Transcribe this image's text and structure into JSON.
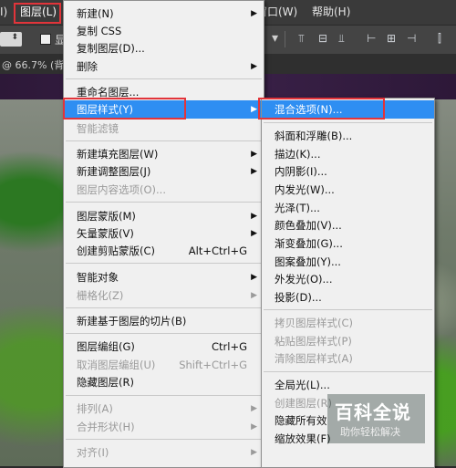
{
  "menubar": {
    "items": [
      "I)",
      "图层(L)",
      "窗口(W)",
      "帮助(H)"
    ]
  },
  "tab": {
    "text": "@ 66.7% (背景"
  },
  "optbar": {
    "checkbox_label": "显"
  },
  "layer_menu": {
    "items": [
      {
        "label": "新建(N)",
        "arrow": true
      },
      {
        "label": "复制 CSS"
      },
      {
        "label": "复制图层(D)..."
      },
      {
        "label": "删除",
        "arrow": true
      },
      {
        "label": "重命名图层..."
      },
      {
        "label": "图层样式(Y)",
        "arrow": true,
        "highlighted": true
      },
      {
        "label": "智能滤镜",
        "disabled": true
      },
      {
        "label": "新建填充图层(W)",
        "arrow": true
      },
      {
        "label": "新建调整图层(J)",
        "arrow": true
      },
      {
        "label": "图层内容选项(O)...",
        "disabled": true
      },
      {
        "label": "图层蒙版(M)",
        "arrow": true
      },
      {
        "label": "矢量蒙版(V)",
        "arrow": true
      },
      {
        "label": "创建剪贴蒙版(C)",
        "shortcut": "Alt+Ctrl+G"
      },
      {
        "label": "智能对象",
        "arrow": true
      },
      {
        "label": "栅格化(Z)",
        "arrow": true,
        "disabled": true
      },
      {
        "label": "新建基于图层的切片(B)"
      },
      {
        "label": "图层编组(G)",
        "shortcut": "Ctrl+G"
      },
      {
        "label": "取消图层编组(U)",
        "shortcut": "Shift+Ctrl+G",
        "disabled": true
      },
      {
        "label": "隐藏图层(R)"
      },
      {
        "label": "排列(A)",
        "arrow": true,
        "disabled": true
      },
      {
        "label": "合并形状(H)",
        "arrow": true,
        "disabled": true
      },
      {
        "label": "对齐(I)",
        "arrow": true,
        "disabled": true
      }
    ]
  },
  "style_submenu": {
    "items": [
      {
        "label": "混合选项(N)...",
        "highlighted": true
      },
      {
        "label": "斜面和浮雕(B)..."
      },
      {
        "label": "描边(K)..."
      },
      {
        "label": "内阴影(I)..."
      },
      {
        "label": "内发光(W)..."
      },
      {
        "label": "光泽(T)..."
      },
      {
        "label": "颜色叠加(V)..."
      },
      {
        "label": "渐变叠加(G)..."
      },
      {
        "label": "图案叠加(Y)..."
      },
      {
        "label": "外发光(O)..."
      },
      {
        "label": "投影(D)..."
      },
      {
        "label": "拷贝图层样式(C)",
        "disabled": true
      },
      {
        "label": "粘贴图层样式(P)",
        "disabled": true
      },
      {
        "label": "清除图层样式(A)",
        "disabled": true
      },
      {
        "label": "全局光(L)..."
      },
      {
        "label": "创建图层(R)",
        "disabled": true
      },
      {
        "label": "隐藏所有效"
      },
      {
        "label": "缩放效果(F)"
      }
    ]
  },
  "watermark": {
    "title": "百科全说",
    "subtitle": "助你轻松解决"
  },
  "colors": {
    "highlight": "#2e8ef2",
    "selection_box": "#e2343a",
    "menu_bg": "#f0f0f0"
  }
}
